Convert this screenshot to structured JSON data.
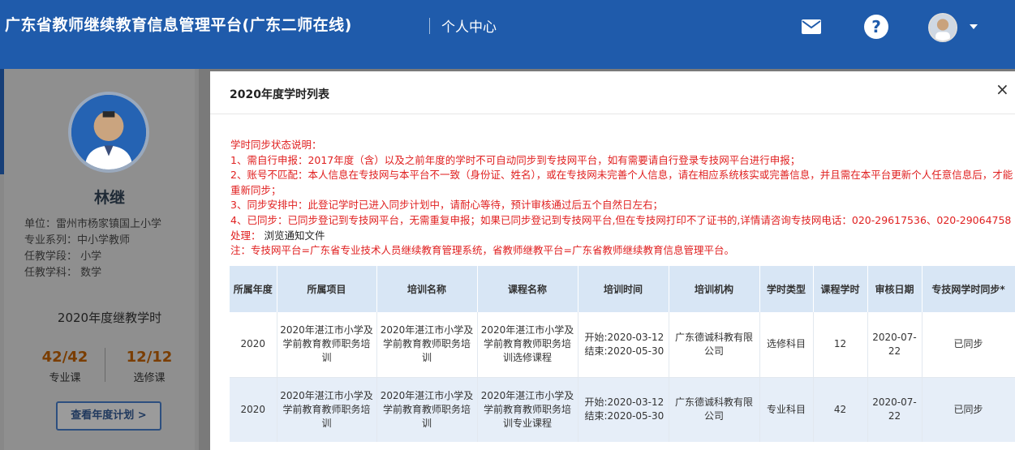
{
  "header": {
    "platform_title": "广东省教师继续教育信息管理平台(广东二师在线)",
    "section_title": "个人中心",
    "icons": [
      "mail-icon",
      "help-icon",
      "user-avatar",
      "chevron-down-icon"
    ]
  },
  "profile": {
    "name": "林继",
    "unit": "单位：雷州市杨家镇国上小学",
    "major_series": "专业系列：中小学教师",
    "teaching_stage": "任教学段：  小学",
    "teaching_subject": "任教学科：  数学",
    "year_title": "2020年度继教学时",
    "professional_count": "42/42",
    "professional_label": "专业课",
    "elective_count": "12/12",
    "elective_label": "选修课",
    "plan_button": "查看年度计划 >"
  },
  "modal": {
    "title": "2020年度学时列表",
    "close": "×",
    "notes": [
      "学时同步状态说明：",
      "1、需自行申报：2017年度（含）以及之前年度的学时不可自动同步到专技网平台，如有需要请自行登录专技网平台进行申报；",
      "2、账号不匹配：本人信息在专技网与本平台不一致（身份证、姓名），或在专技网未完善个人信息，请在相应系统核实或完善信息，并且需在本平台更新个人任意信息后，才能重新同步；",
      "3、同步安排中：此登记学时已进入同步计划中，请耐心等待，预计审核通过后五个自然日左右；",
      "4、已同步：已同步登记到专技网平台，无需重复申报；如果已同步登记到专技网平台,但在专技网打印不了证书的,详情请咨询专技网电话：020-29617536、020-29064758 处理：",
      "注：专技网平台=广东省专业技术人员继续教育管理系统，省教师继教平台=广东省教师继续教育信息管理平台。"
    ],
    "note_link": "浏览通知文件"
  },
  "table": {
    "columns": [
      "所属年度",
      "所属项目",
      "培训名称",
      "课程名称",
      "培训时间",
      "培训机构",
      "学时类型",
      "课程学时",
      "审核日期",
      "专技网学时同步*"
    ],
    "rows": [
      {
        "year": "2020",
        "project": "2020年湛江市小学及学前教育教师职务培训",
        "training": "2020年湛江市小学及学前教育教师职务培训",
        "course": "2020年湛江市小学及学前教育教师职务培训选修课程",
        "start": "开始:2020-03-12",
        "end": "结束:2020-05-30",
        "org": "广东德诚科教有限公司",
        "type": "选修科目",
        "hours": "12",
        "audit_date": "2020-07-22",
        "sync": "已同步"
      },
      {
        "year": "2020",
        "project": "2020年湛江市小学及学前教育教师职务培训",
        "training": "2020年湛江市小学及学前教育教师职务培训",
        "course": "2020年湛江市小学及学前教育教师职务培训专业课程",
        "start": "开始:2020-03-12",
        "end": "结束:2020-05-30",
        "org": "广东德诚科教有限公司",
        "type": "专业科目",
        "hours": "42",
        "audit_date": "2020-07-22",
        "sync": "已同步"
      }
    ]
  }
}
